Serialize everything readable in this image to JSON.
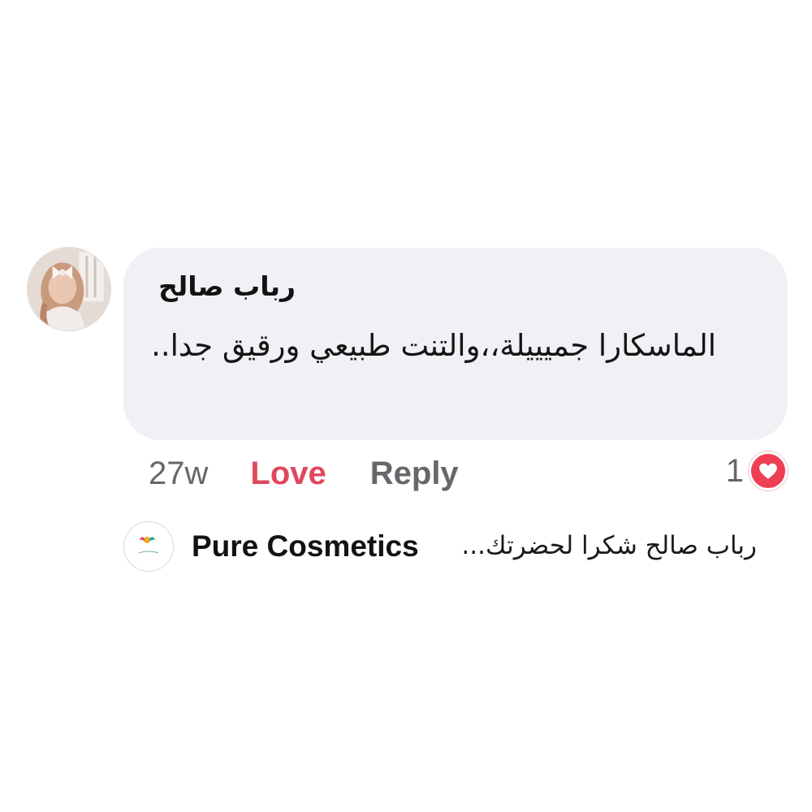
{
  "comment": {
    "author": "رباب صالح",
    "text": "الماسكارا جميييلة،،والتنت طبيعي ورقيق جدا..",
    "time": "27w",
    "love_label": "Love",
    "reply_label": "Reply",
    "reaction_count": "1",
    "reaction_icon": "heart-icon",
    "colors": {
      "bubble": "#f0f1f5",
      "love": "#e0475e",
      "meta": "#65676b",
      "heart": "#ee3f54"
    }
  },
  "reply": {
    "page_name": "Pure Cosmetics",
    "preview": "رباب صالح شكرا لحضرتك...",
    "logo_text": "Pure Cosmetics"
  }
}
